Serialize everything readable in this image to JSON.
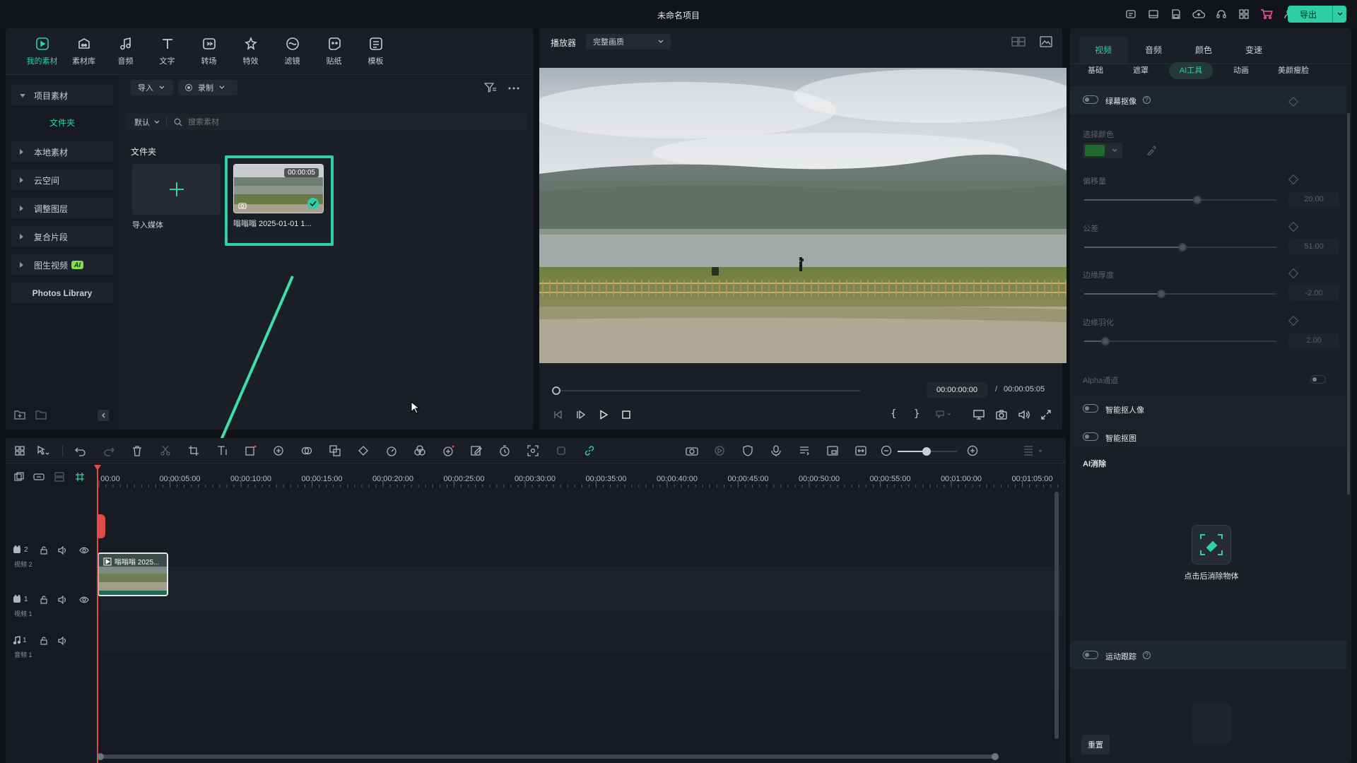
{
  "app": {
    "title": "未命名项目",
    "export_label": "导出"
  },
  "library": {
    "tabs": [
      {
        "label": "我的素材",
        "icon": "my-media-icon"
      },
      {
        "label": "素材库",
        "icon": "stock-media-icon"
      },
      {
        "label": "音频",
        "icon": "audio-icon"
      },
      {
        "label": "文字",
        "icon": "text-icon"
      },
      {
        "label": "转场",
        "icon": "transition-icon"
      },
      {
        "label": "特效",
        "icon": "effects-icon"
      },
      {
        "label": "滤镜",
        "icon": "filter-icon"
      },
      {
        "label": "贴纸",
        "icon": "sticker-icon"
      },
      {
        "label": "模板",
        "icon": "template-icon"
      }
    ],
    "sidebar": {
      "project_media": "项目素材",
      "folder": "文件夹",
      "items": [
        "本地素材",
        "云空间",
        "调整图层",
        "复合片段",
        "图生视频"
      ],
      "ai_badge": "AI",
      "photos_library": "Photos Library"
    },
    "import_label": "导入",
    "record_label": "录制",
    "sort_label": "默认",
    "search_placeholder": "搜索素材",
    "folder_heading": "文件夹",
    "import_media_label": "导入媒体",
    "clip": {
      "name": "嗡嗡嗡 2025-01-01 1...",
      "duration": "00:00:05"
    }
  },
  "player": {
    "label": "播放器",
    "quality": "完整画质",
    "current_time": "00:00:00:00",
    "separator": "/",
    "total_time": "00:00:05:05"
  },
  "properties": {
    "tabs": [
      "视频",
      "音频",
      "颜色",
      "变速"
    ],
    "subtabs": [
      "基础",
      "遮罩",
      "AI工具",
      "动画",
      "美颜瘦脸"
    ],
    "chroma_key": "绿幕抠像",
    "select_color": "选择颜色",
    "swatch_color": "#1f6b2a",
    "offset": {
      "label": "偏移量",
      "value": "20.00",
      "level": 0.59
    },
    "tolerance": {
      "label": "公差",
      "value": "51.00",
      "level": 0.51
    },
    "edge_thickness": {
      "label": "边缘厚度",
      "value": "-2.00",
      "level": 0.4
    },
    "edge_feather": {
      "label": "边缘羽化",
      "value": "2.00",
      "level": 0.11
    },
    "alpha": "Alpha通道",
    "smart_cutout_person": "智能抠人像",
    "smart_cutout": "智能抠图",
    "ai_erase_heading": "AI消除",
    "ai_erase_button": "点击后消除物体",
    "motion_tracking": "运动跟踪",
    "reset_label": "重置"
  },
  "timeline": {
    "ruler": [
      "00:00",
      "00:00:05:00",
      "00:00:10:00",
      "00:00:15:00",
      "00:00:20:00",
      "00:00:25:00",
      "00:00:30:00",
      "00:00:35:00",
      "00:00:40:00",
      "00:00:45:00",
      "00:00:50:00",
      "00:00:55:00",
      "00:01:00:00",
      "00:01:05:00"
    ],
    "tracks": [
      {
        "num": "2",
        "name": "视频 2"
      },
      {
        "num": "1",
        "name": "视频 1"
      },
      {
        "num": "1",
        "name": "音频 1"
      }
    ],
    "clip_label": "嗡嗡嗡 2025..."
  },
  "colors": {
    "accent": "#2ed0a3",
    "playhead": "#e24a4a"
  }
}
